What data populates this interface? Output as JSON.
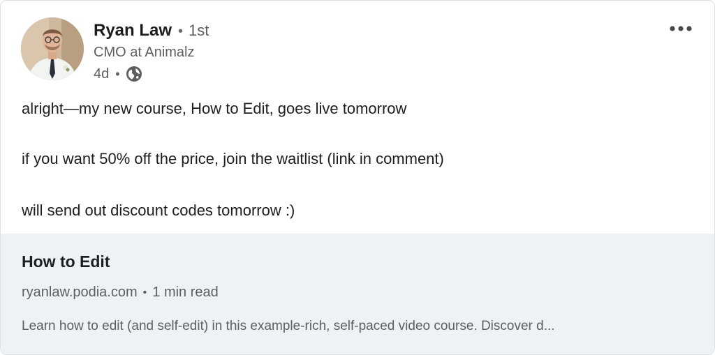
{
  "post": {
    "author": {
      "name": "Ryan Law",
      "connection_degree": "1st",
      "headline": "CMO at Animalz",
      "time_ago": "4d",
      "visibility_icon": "globe-icon"
    },
    "menu_icon": "more-horizontal-icon",
    "body_lines": [
      "alright—my new course, How to Edit, goes live tomorrow",
      "if you want 50% off the price, join the waitlist (link in comment)",
      "will send out discount codes tomorrow :)"
    ],
    "link_preview": {
      "title": "How to Edit",
      "domain": "ryanlaw.podia.com",
      "read_time": "1 min read",
      "description": "Learn how to edit (and self-edit) in this example-rich, self-paced video course. Discover d..."
    }
  },
  "colors": {
    "text_primary": "#1d1d1d",
    "text_secondary": "#5e5e5e",
    "preview_background": "#edf2f6",
    "card_background": "#ffffff"
  }
}
